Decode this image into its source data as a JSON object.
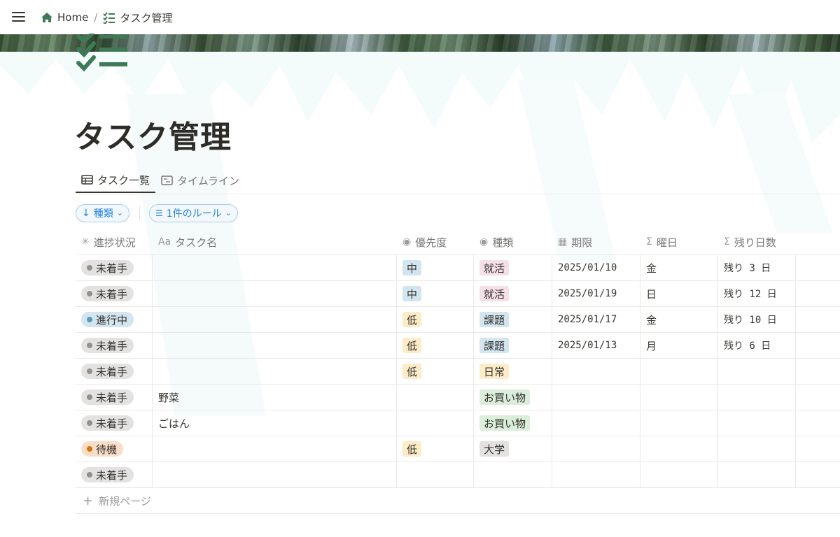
{
  "breadcrumb": {
    "home": "Home",
    "separator": "/",
    "current": "タスク管理"
  },
  "page": {
    "title": "タスク管理"
  },
  "tabs": [
    {
      "label": "タスク一覧",
      "icon": "table-icon",
      "active": true
    },
    {
      "label": "タイムライン",
      "icon": "timeline-icon",
      "active": false
    }
  ],
  "filters": {
    "sort_label": "種類",
    "rule_label": "1件のルール"
  },
  "columns": [
    "進捗状況",
    "タスク名",
    "優先度",
    "種類",
    "期限",
    "曜日",
    "残り日数"
  ],
  "colors": {
    "status_not_started": "#e3e2e0",
    "status_in_progress": "#d3e5ef",
    "status_waiting": "#fadec9",
    "priority_mid": "#d3e5ef",
    "priority_low": "#fdecc8",
    "type_job": "#f5e0e9",
    "type_assignment": "#d3e5ef",
    "type_daily": "#fdecc8",
    "type_shopping": "#dbeddb",
    "type_university": "#e3e2e0"
  },
  "rows": [
    {
      "status": "未着手",
      "name": "",
      "priority": "中",
      "type": "就活",
      "deadline": "2025/01/10",
      "weekday": "金",
      "remaining": "残り 3 日"
    },
    {
      "status": "未着手",
      "name": "",
      "priority": "中",
      "type": "就活",
      "deadline": "2025/01/19",
      "weekday": "日",
      "remaining": "残り 12 日"
    },
    {
      "status": "進行中",
      "name": "",
      "priority": "低",
      "type": "課題",
      "deadline": "2025/01/17",
      "weekday": "金",
      "remaining": "残り 10 日"
    },
    {
      "status": "未着手",
      "name": "",
      "priority": "低",
      "type": "課題",
      "deadline": "2025/01/13",
      "weekday": "月",
      "remaining": "残り 6 日"
    },
    {
      "status": "未着手",
      "name": "",
      "priority": "低",
      "type": "日常",
      "deadline": "",
      "weekday": "",
      "remaining": ""
    },
    {
      "status": "未着手",
      "name": "野菜",
      "priority": "",
      "type": "お買い物",
      "deadline": "",
      "weekday": "",
      "remaining": ""
    },
    {
      "status": "未着手",
      "name": "ごはん",
      "priority": "",
      "type": "お買い物",
      "deadline": "",
      "weekday": "",
      "remaining": ""
    },
    {
      "status": "待機",
      "name": "",
      "priority": "低",
      "type": "大学",
      "deadline": "",
      "weekday": "",
      "remaining": ""
    },
    {
      "status": "未着手",
      "name": "",
      "priority": "",
      "type": "",
      "deadline": "",
      "weekday": "",
      "remaining": ""
    }
  ],
  "new_page_label": "新規ページ"
}
